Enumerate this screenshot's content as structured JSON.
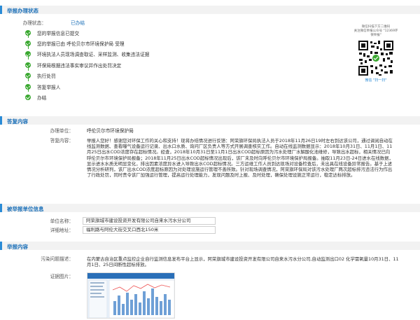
{
  "status_section": {
    "title": "举报办理状态",
    "status_label": "办理状态：",
    "status_value": "已办结",
    "steps": [
      "您的举报信息已提交",
      "您的举报已由 呼伦贝尔市环境保护局 受理",
      "环境执法人员现场调查取证、采样监测、收集违法证据",
      "环保局根据违法事实审议并作出处罚决定",
      "执行处罚",
      "答复举报人",
      "办结"
    ],
    "qr_caption_1": "微信扫描下方二维码",
    "qr_caption_2": "关注微信举报公众号 \"12369环保举报\"",
    "qr_scan_label": "微信 \"扫一扫\""
  },
  "reply_section": {
    "title": "答复内容",
    "unit_label": "办理单位：",
    "unit_value": "呼伦贝尔市环境保护局",
    "content_label": "答复内容：",
    "content_value": "举报人您好！感谢您对环保工作的关心和支持！现将办结情况进行反馈：阿荣旗环保局执法人员于2018年11月26日19时左右到达该公司，通过调阅自动在线监测数据、查看曝气设备运行记录、出水口水质、询问厂区负责人等方式开展调查核实工作。自动在线监测数据显示：2018年10月31日、11月1日、11月25日出水COD浓度存在超标情况。经查，2018年10月31日至11月1日出水COD超标原因为污水处理厂水解酸化池维修，导致出水超标，相关情况已向呼伦贝尔市环境保护局报备；2018年11月25日出水COD超标情况出现后，该厂未及时向呼伦贝尔市环境保护局报备。抽取11月23日-24日进水在线数据，显示进水水质无明显变化，排出因素浓度异水进入导致出水COD超标情况。三方运维工作人员到达现场对设备检查后，未出具在线设备异常报告。基于上述情况分析研判，该厂出水COD浓度超标原因为对处理设施运行管理不善所致。针对现场调查情况，阿荣旗环保局对该污水处理厂两次超标排污违法行为作出了行政处罚，同时责令该厂加强运行管理，提高运行处理能力，发现问题及时上报、及时处理，确保处理设施正常运行，稳定达标排放。"
  },
  "reported_section": {
    "title": "被举报单位信息",
    "unit_label": "单位名称：",
    "unit_value": "阿荣旗城市建设投资开发有限公司自来水污水分公司",
    "address_label": "详细地址：",
    "address_value": "福利路与阿伦大街交叉口西北150米"
  },
  "report_section": {
    "title": "举报内容",
    "problem_label": "污染问题描述：",
    "problem_value": "在内蒙古自治区重点监控企业自行监测信息发布平台上显示，阿荣旗城市建设投资开发有限公司自来水污水分公司,自动监测出口02 化学需氧量10月31日、11月1日、25日间断性超标排放。",
    "evidence_label": "证据图片："
  },
  "colors": {
    "accent": "#1a6fb8",
    "success": "#3aa830"
  }
}
